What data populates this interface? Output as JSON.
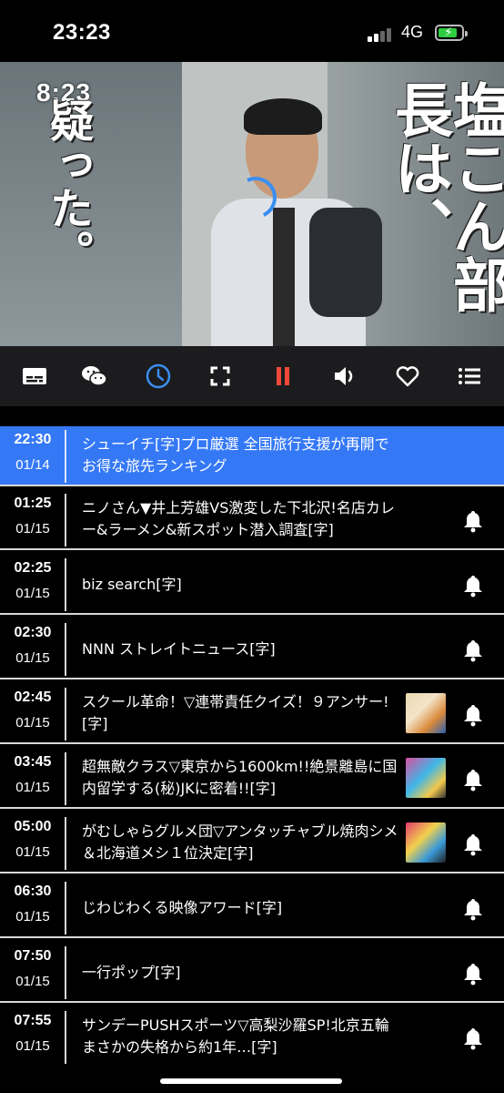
{
  "status_bar": {
    "time": "23:23",
    "network": "4G",
    "battery_color": "#2ecc40"
  },
  "video": {
    "clock_overlay": "8:23",
    "overlay_left_text": "疑った。",
    "overlay_right_text": "塩こん部長は、",
    "spinner_color": "#3a8ef0"
  },
  "controls": [
    {
      "name": "subtitle-icon",
      "active": false
    },
    {
      "name": "wechat-icon",
      "active": false
    },
    {
      "name": "clock-icon",
      "active": true
    },
    {
      "name": "fullscreen-icon",
      "active": false
    },
    {
      "name": "pause-icon",
      "active": true
    },
    {
      "name": "volume-icon",
      "active": false
    },
    {
      "name": "heart-icon",
      "active": false
    },
    {
      "name": "menu-icon",
      "active": false
    }
  ],
  "accent_color": "#3478f6",
  "pause_color": "#f0493a",
  "schedule": [
    {
      "time": "22:30",
      "date": "01/14",
      "title": "シューイチ[字]プロ厳選 全国旅行支援が再開でお得な旅先ランキング",
      "active": true,
      "thumb": false,
      "bell": false
    },
    {
      "time": "01:25",
      "date": "01/15",
      "title": "ニノさん▼井上芳雄VS激変した下北沢!名店カレー&ラーメン&新スポット潜入調査[字]",
      "active": false,
      "thumb": false,
      "bell": true
    },
    {
      "time": "02:25",
      "date": "01/15",
      "title": "biz search[字]",
      "active": false,
      "thumb": false,
      "bell": true
    },
    {
      "time": "02:30",
      "date": "01/15",
      "title": "NNN ストレイトニュース[字]",
      "active": false,
      "thumb": false,
      "bell": true
    },
    {
      "time": "02:45",
      "date": "01/15",
      "title": "スクール革命！▽連帯責任クイズ！９アンサー![字]",
      "active": false,
      "thumb": true,
      "bell": true
    },
    {
      "time": "03:45",
      "date": "01/15",
      "title": "超無敵クラス▽東京から1600km!!絶景離島に国内留学する(秘)JKに密着!![字]",
      "active": false,
      "thumb": true,
      "bell": true
    },
    {
      "time": "05:00",
      "date": "01/15",
      "title": "がむしゃらグルメ団▽アンタッチャブル焼肉シメ＆北海道メシ１位決定[字]",
      "active": false,
      "thumb": true,
      "bell": true
    },
    {
      "time": "06:30",
      "date": "01/15",
      "title": "じわじわくる映像アワード[字]",
      "active": false,
      "thumb": false,
      "bell": true
    },
    {
      "time": "07:50",
      "date": "01/15",
      "title": "一行ポップ[字]",
      "active": false,
      "thumb": false,
      "bell": true
    },
    {
      "time": "07:55",
      "date": "01/15",
      "title": "サンデーPUSHスポーツ▽高梨沙羅SP!北京五輪まさかの失格から約1年…[字]",
      "active": false,
      "thumb": false,
      "bell": true
    }
  ]
}
